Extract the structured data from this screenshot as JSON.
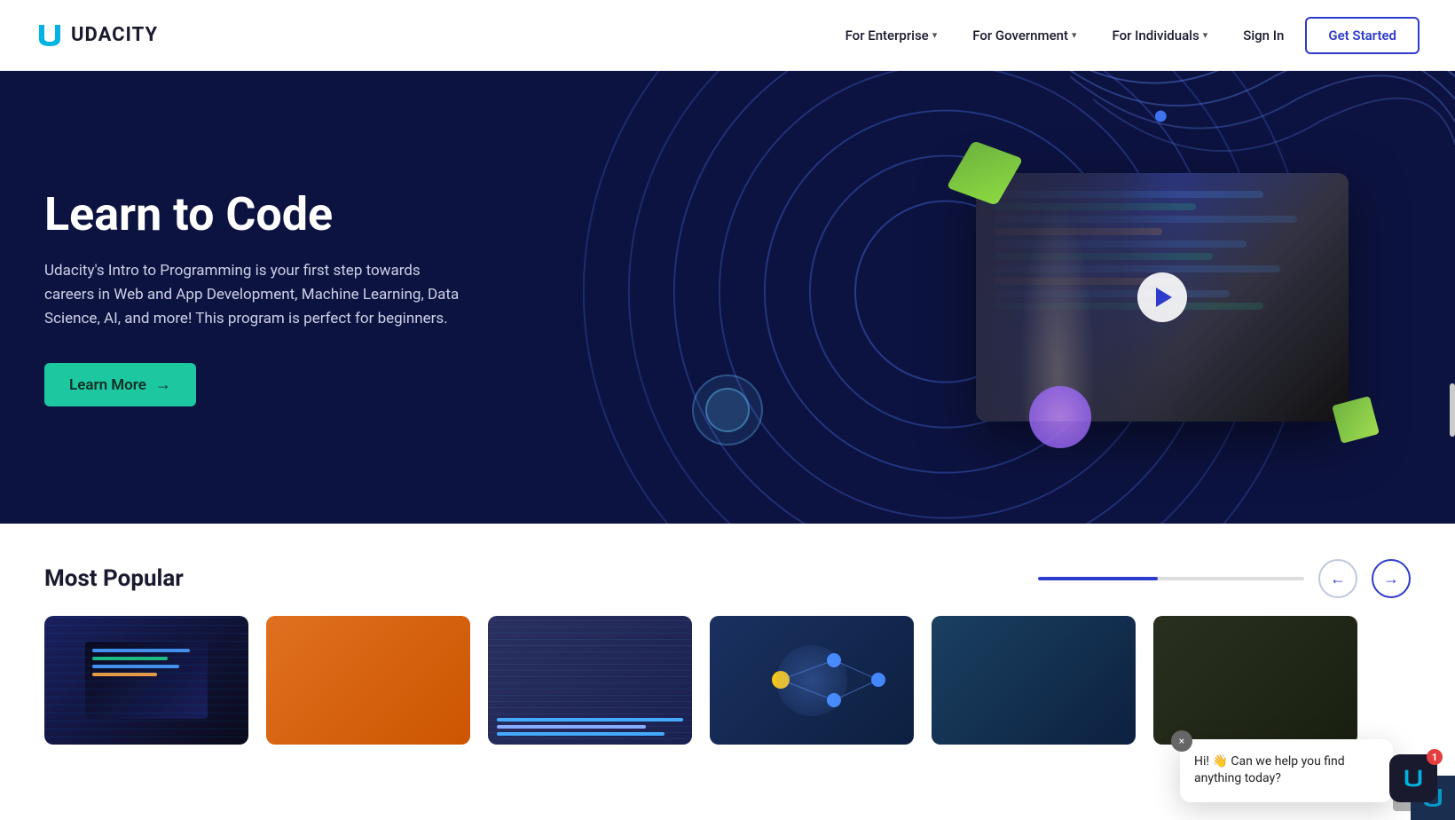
{
  "navbar": {
    "logo_text": "UDACITY",
    "nav_items": [
      {
        "label": "For Enterprise",
        "has_dropdown": true
      },
      {
        "label": "For Government",
        "has_dropdown": true
      },
      {
        "label": "For Individuals",
        "has_dropdown": true
      }
    ],
    "signin_label": "Sign In",
    "cta_label": "Get Started"
  },
  "hero": {
    "title": "Learn to Code",
    "description": "Udacity's Intro to Programming is your first step towards careers in Web and App Development, Machine Learning, Data Science, AI, and more! This program is perfect for beginners.",
    "cta_label": "Learn More"
  },
  "most_popular": {
    "section_title": "Most Popular",
    "prev_label": "←",
    "next_label": "→",
    "progress_percent": 45
  },
  "chat": {
    "message": "Hi! 👋 Can we help you find anything today?",
    "close_icon": "×",
    "badge_count": "1"
  }
}
